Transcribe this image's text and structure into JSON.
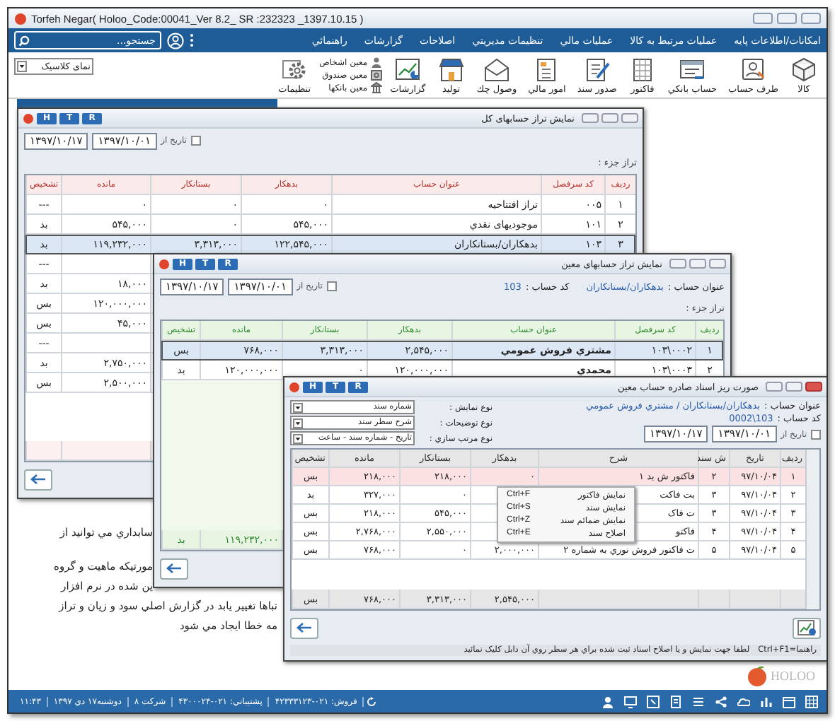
{
  "app": {
    "title": "Torfeh Negar( Holoo_Code:00041_Ver 8.2_ SR :232323 _1397.10.15 )"
  },
  "menu": {
    "search": {
      "placeholder": "جستجو..."
    },
    "items": [
      "امکانات/اطلاعات پایه",
      "عملیات مرتبط به کالا",
      "عملیات مالي",
      "تنظیمات مدیریتي",
      "اصلاحات",
      "گزارشات",
      "راهنمائي"
    ]
  },
  "toolbar": {
    "buttons": [
      {
        "label": "کالا"
      },
      {
        "label": "طرف حساب"
      },
      {
        "label": "حساب بانکي"
      },
      {
        "label": "فاکتور"
      },
      {
        "label": "صدور سند"
      },
      {
        "label": "امور مالي"
      },
      {
        "label": "وصول چك"
      },
      {
        "label": "تولید"
      },
      {
        "label": "گزارشات"
      }
    ],
    "ledger_links": [
      "معین اشخاص",
      "معین صندوق",
      "معین بانکها"
    ],
    "settings": "تنظیمات",
    "view_select": "نمای کلاسیک"
  },
  "help_lines": [
    "سابداري مي توانید از",
    "مورتیکه ماهیت و گروه",
    "ین شده در نرم افزار",
    "تباها تغییر یابد در گزارش اصلي سود و زیان و تراز",
    "مه خطا ایجاد مي شود"
  ],
  "windows": [
    {
      "kind": "rose",
      "title": "نمایش تراز حسابهای کل",
      "buttons": [
        "R",
        "T",
        "H"
      ],
      "date_filter": {
        "label": "تاریخ از",
        "checked": false,
        "from": "۱۳۹۷/۱۰/۰۱",
        "to": "۱۳۹۷/۱۰/۱۷"
      },
      "level_label": "تراز جزء :",
      "columns": [
        "ردیف",
        "کد سرفصل",
        "عنوان حساب",
        "بدهکار",
        "بستانکار",
        "مانده",
        "تشخیص"
      ],
      "rows": [
        {
          "row_no": "۱",
          "code": "۰۰۵",
          "title": "تراز افتتاحیه",
          "debit": "۰",
          "credit": "۰",
          "balance": "۰",
          "status": "---",
          "selected": false
        },
        {
          "row_no": "۲",
          "code": "۱۰۱",
          "title": "موجودیهای نقدي",
          "debit": "۵۴۵,۰۰۰",
          "credit": "۰",
          "balance": "۵۴۵,۰۰۰",
          "status": "بد",
          "selected": false
        },
        {
          "row_no": "۳",
          "code": "۱۰۳",
          "title": "بدهکاران/بستانکاران",
          "debit": "۱۲۲,۵۴۵,۰۰۰",
          "credit": "۳,۳۱۳,۰۰۰",
          "balance": "۱۱۹,۲۳۲,۰۰۰",
          "status": "بد",
          "selected": true
        },
        {
          "status": "---",
          "selected": false
        },
        {
          "balance": "۱۸,۰۰۰",
          "status": "بد",
          "selected": false
        },
        {
          "balance": "۱۲۰,۰۰۰,۰۰۰",
          "status": "بس",
          "selected": false
        },
        {
          "balance": "۴۵,۰۰۰",
          "status": "بس",
          "selected": false
        },
        {
          "status": "---",
          "selected": false
        },
        {
          "balance": "۲,۷۵۰,۰۰۰",
          "status": "بد",
          "selected": false
        },
        {
          "balance": "۲,۵۰۰,۰۰۰",
          "status": "بس",
          "selected": false
        }
      ]
    },
    {
      "kind": "green",
      "title": "نمایش تراز حسابهای معین",
      "buttons": [
        "R",
        "T",
        "H"
      ],
      "info": [
        {
          "label": "عنوان حساب :",
          "value": "بدهکاران/بستانکاران"
        },
        {
          "label": "کد حساب :",
          "value": "103"
        }
      ],
      "date_filter": {
        "label": "تاریخ از",
        "checked": false,
        "from": "۱۳۹۷/۱۰/۰۱",
        "to": "۱۳۹۷/۱۰/۱۷"
      },
      "level_label": "تراز جزء :",
      "columns": [
        "ردیف",
        "کد سرفصل",
        "عنوان حساب",
        "بدهکار",
        "بستانکار",
        "مانده",
        "تشخیص"
      ],
      "rows": [
        {
          "row_no": "۱",
          "code": "۱۰۳\\۰۰۰۲",
          "title": "مشتري فروش عمومي",
          "debit": "۲,۵۴۵,۰۰۰",
          "credit": "۳,۳۱۳,۰۰۰",
          "balance": "۷۶۸,۰۰۰",
          "status": "بس",
          "selected": true
        },
        {
          "row_no": "۲",
          "code": "۱۰۳\\۰۰۰۳",
          "title": "محمدي",
          "debit": "۱۲۰,۰۰۰,۰۰۰",
          "credit": "۰",
          "balance": "۱۲۰,۰۰۰,۰۰۰",
          "status": "بد",
          "selected": false
        }
      ],
      "footer": {
        "balance": "۱۱۹,۲۳۲,۰۰۰",
        "status": "بد"
      }
    },
    {
      "kind": "plain",
      "title": "صورت ریز اسناد صادره حساب معین",
      "buttons": [
        "R",
        "T",
        "H"
      ],
      "info": [
        {
          "label": "عنوان حساب :",
          "value": "بدهکاران/بستانکاران / مشتري فروش عمومي"
        },
        {
          "label": "کد حساب :",
          "value": "103\\0002"
        }
      ],
      "options": [
        {
          "label": "نوع نمایش :",
          "value": "شماره سند"
        },
        {
          "label": "نوع توضیحات :",
          "value": "شرح سطر سند"
        },
        {
          "label": "نوع مرتب سازي :",
          "value": "تاریخ - شماره سند - ساعت"
        }
      ],
      "date_filter": {
        "label": "تاریخ از",
        "checked": false,
        "from": "۱۳۹۷/۱۰/۰۱",
        "to": "۱۳۹۷/۱۰/۱۷"
      },
      "columns": [
        "ردیف",
        "تاریخ",
        "ش سند",
        "شرح",
        "بدهکار",
        "بستانکار",
        "مانده",
        "تشخیص"
      ],
      "rows": [
        {
          "row_no": "۱",
          "date": "۹۷/۱۰/۰۴",
          "doc_no": "۲",
          "description": "فاکتور ش بد ۱",
          "debit": "۰",
          "credit": "۲۱۸,۰۰۰",
          "balance": "۲۱۸,۰۰۰",
          "status": "بس",
          "selected": true
        },
        {
          "row_no": "۲",
          "date": "۹۷/۱۰/۰۴",
          "doc_no": "۳",
          "description": "بت فاکت",
          "credit": "۰",
          "balance": "۳۲۷,۰۰۰",
          "status": "بد",
          "selected": false
        },
        {
          "row_no": "۳",
          "date": "۹۷/۱۰/۰۴",
          "doc_no": "۳",
          "description": "ت فاک",
          "credit": "۵۴۵,۰۰۰",
          "balance": "۲۱۸,۰۰۰",
          "status": "بس",
          "selected": false
        },
        {
          "row_no": "۴",
          "date": "۹۷/۱۰/۰۴",
          "doc_no": "۴",
          "description": "فاکتو",
          "credit": "۲,۵۵۰,۰۰۰",
          "balance": "۲,۷۶۸,۰۰۰",
          "status": "بس",
          "selected": false
        },
        {
          "row_no": "۵",
          "date": "۹۷/۱۰/۰۴",
          "doc_no": "۵",
          "description": "ت فاکتور فروش نوري به شماره ۲",
          "debit": "۲,۰۰۰,۰۰۰",
          "credit": "۰",
          "balance": "۷۶۸,۰۰۰",
          "status": "بس",
          "selected": false
        }
      ],
      "footer": {
        "debit": "۲,۵۴۵,۰۰۰",
        "credit": "۳,۳۱۳,۰۰۰",
        "balance": "۷۶۸,۰۰۰",
        "status": "بس"
      },
      "chart_button": true,
      "hint": {
        "shortcut": "راهنما=Ctrl+F1",
        "text": "لطفا جهت نمایش و یا اصلاح اسناد ثبت شده براي هر سطر روي آن دابل کلیک نمائید"
      },
      "context_menu": [
        {
          "label": "نمایش فاکتور",
          "shortcut": "Ctrl+F"
        },
        {
          "label": "نمایش سند",
          "shortcut": "Ctrl+S"
        },
        {
          "label": "نمایش ضمائم سند",
          "shortcut": "Ctrl+Z"
        },
        {
          "label": "اصلاح سند",
          "shortcut": "Ctrl+E"
        }
      ]
    }
  ],
  "status_bar": {
    "items": [
      "فروش: ۰۲۱-۴۲۳۳۳۱۲۳",
      "پشتیباني: ۰۲۱-۴۳۰۰۰۲۴",
      "شرکت ۸",
      "دوشنبه۱۷ دي ۱۳۹۷",
      "۱۱:۴۳"
    ]
  },
  "logo": "HOLOO"
}
